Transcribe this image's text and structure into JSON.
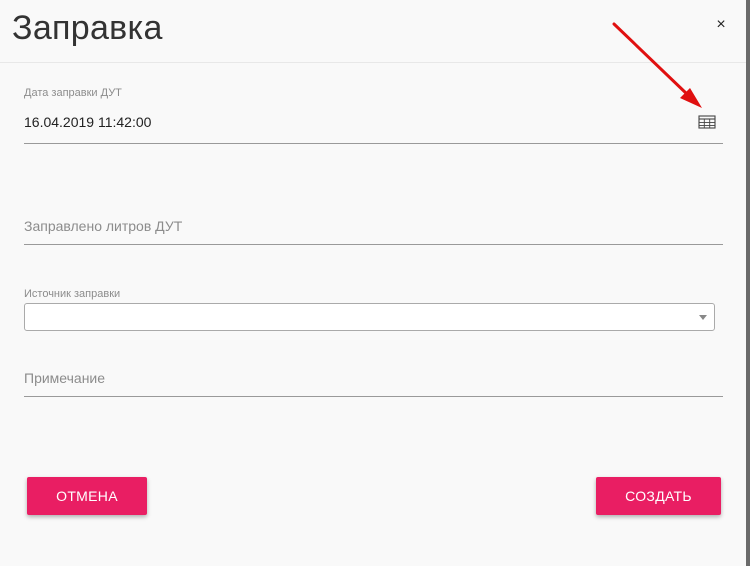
{
  "dialog": {
    "title": "Заправка",
    "close_label": "×"
  },
  "fields": {
    "date": {
      "label": "Дата заправки ДУТ",
      "value": "16.04.2019 11:42:00",
      "icon": "calendar-icon"
    },
    "liters": {
      "placeholder": "Заправлено литров ДУТ"
    },
    "source": {
      "label": "Источник заправки",
      "value": ""
    },
    "note": {
      "placeholder": "Примечание"
    }
  },
  "buttons": {
    "cancel": "ОТМЕНА",
    "create": "СОЗДАТЬ"
  },
  "colors": {
    "accent": "#e91e63",
    "annotation_arrow": "#e01010"
  }
}
